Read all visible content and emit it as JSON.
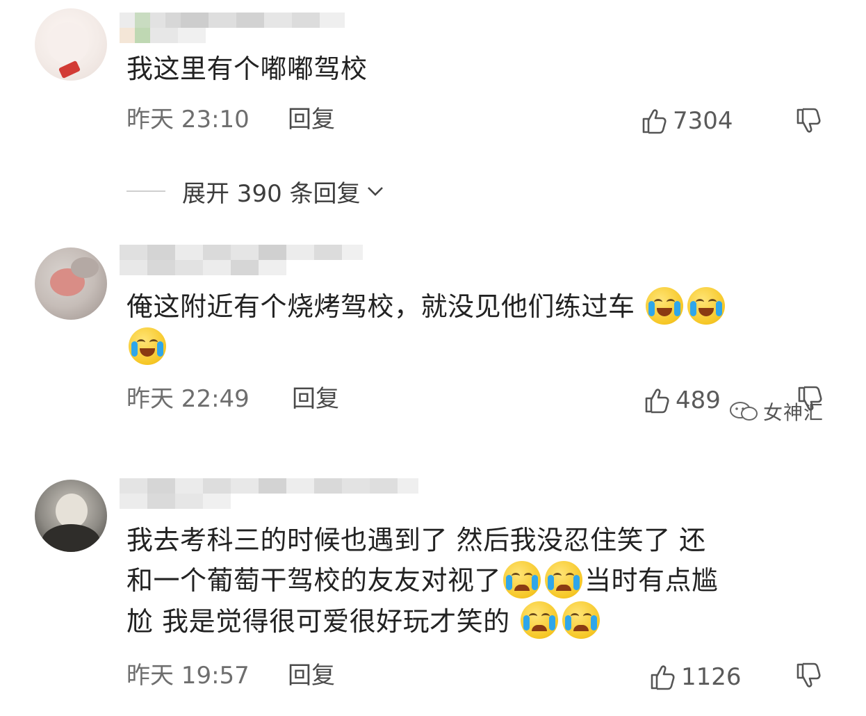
{
  "comments": [
    {
      "text": "我这里有个嘟嘟驾校",
      "time": "昨天 23:10",
      "reply_label": "回复",
      "likes": "7304",
      "emojis": [],
      "expand_replies": "展开 390 条回复"
    },
    {
      "text": "俺这附近有个烧烤驾校，就没见他们练过车",
      "time": "昨天 22:49",
      "reply_label": "回复",
      "likes": "489",
      "emojis": [
        "laughing-tears-emoji",
        "laughing-tears-emoji",
        "laughing-tears-emoji"
      ]
    },
    {
      "text_line1": "我去考科三的时候也遇到了 然后我没忍住笑了 还",
      "text_line2_a": "和一个葡萄干驾校的友友对视了",
      "text_line2_b": "当时有点尴",
      "text_line3": "尬 我是觉得很可爱很好玩才笑的",
      "time": "昨天 19:57",
      "reply_label": "回复",
      "likes": "1126",
      "emojis": [
        "crying-emoji",
        "crying-emoji",
        "crying-emoji",
        "crying-emoji"
      ]
    }
  ],
  "watermark": "女神汇",
  "colors": {
    "background": "#ffffff",
    "text": "#222222",
    "meta": "#6e6e6e",
    "emoji_yellow": "#f6c726",
    "tear_blue": "#2fa6ea"
  }
}
